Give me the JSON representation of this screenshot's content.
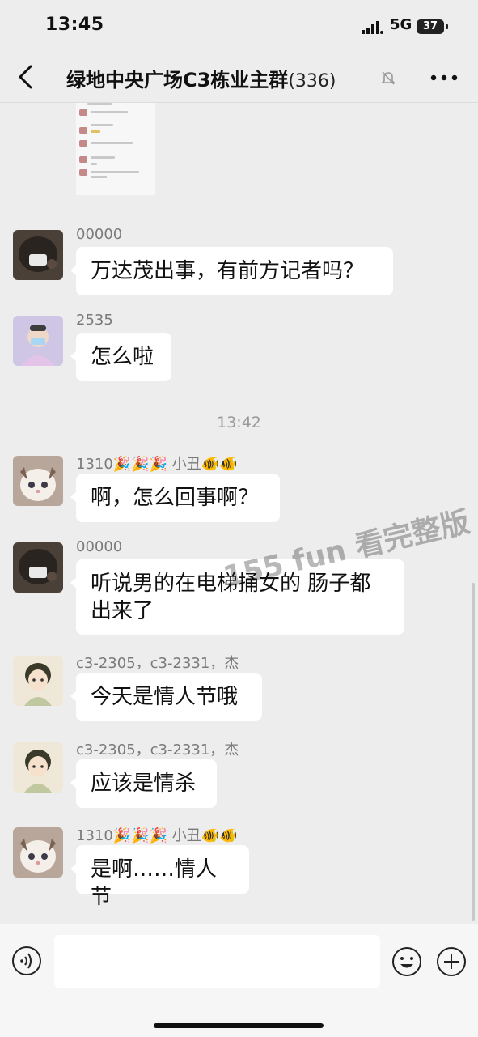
{
  "status_bar": {
    "time": "13:45",
    "network": "5G",
    "battery": "37"
  },
  "header": {
    "title": "绿地中央广场C3栋业主群",
    "member_count": "(336)"
  },
  "messages": [
    {
      "sender": "00000",
      "text": "万达茂出事，有前方记者吗？"
    },
    {
      "sender": "2535",
      "text": "怎么啦"
    },
    {
      "sender": "1310🎉🎉🎉 小丑🐠🐠",
      "text": "啊，怎么回事啊？"
    },
    {
      "sender": "00000",
      "text_line1": "听说男的在电梯捅女的 肠子都",
      "text_line2": "出来了"
    },
    {
      "sender": "c3-2305，c3-2331，杰",
      "text": "今天是情人节哦"
    },
    {
      "sender": "c3-2305，c3-2331，杰",
      "text": "应该是情杀"
    },
    {
      "sender": "1310🎉🎉🎉 小丑🐠🐠",
      "text": "是啊……情人节"
    }
  ],
  "timestamp": "13:42",
  "watermark": "155 fun 看完整版",
  "icons": {
    "back": "back-arrow-icon",
    "mute": "bell-slash-icon",
    "more": "ellipsis-icon",
    "voice": "voice-input-icon",
    "emoji": "smiley-icon",
    "plus": "add-icon"
  }
}
